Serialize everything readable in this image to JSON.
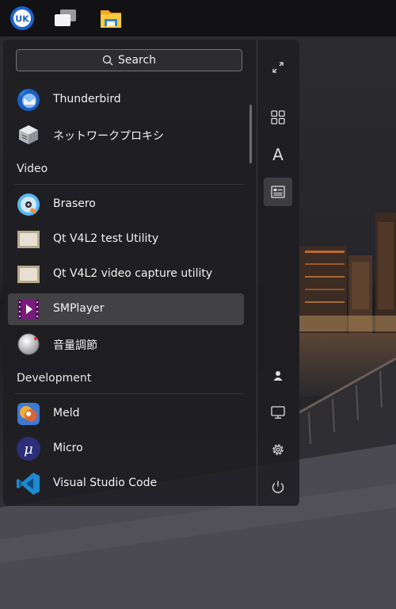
{
  "taskbar": {
    "items": [
      {
        "name": "start-menu",
        "icon": "ukui-logo-icon"
      },
      {
        "name": "multitasking",
        "icon": "windows-stack-icon"
      },
      {
        "name": "file-manager",
        "icon": "folder-icon"
      }
    ],
    "logo_text": "UK"
  },
  "menu": {
    "search_label": "Search",
    "categories": {
      "video": "Video",
      "development": "Development"
    },
    "apps": [
      {
        "label": "Thunderbird",
        "icon": "thunderbird-icon"
      },
      {
        "label": "ネットワークプロキシ",
        "icon": "network-proxy-icon"
      },
      {
        "label": "Brasero",
        "icon": "brasero-icon"
      },
      {
        "label": "Qt V4L2 test Utility",
        "icon": "qt-v4l2-icon"
      },
      {
        "label": "Qt V4L2 video capture utility",
        "icon": "qt-v4l2-icon"
      },
      {
        "label": "SMPlayer",
        "icon": "smplayer-icon",
        "highlighted": true
      },
      {
        "label": "音量調節",
        "icon": "volume-control-icon"
      },
      {
        "label": "Meld",
        "icon": "meld-icon"
      },
      {
        "label": "Micro",
        "icon": "micro-icon",
        "glyph": "μ"
      },
      {
        "label": "Visual Studio Code",
        "icon": "vscode-icon"
      }
    ],
    "sidebar": [
      {
        "name": "expand",
        "icon": "expand-icon"
      },
      {
        "name": "category-view",
        "icon": "grid-icon"
      },
      {
        "name": "alphabetical-view",
        "icon": "letter-a-icon",
        "glyph": "A"
      },
      {
        "name": "function-view",
        "icon": "function-list-icon",
        "active": true
      },
      {
        "name": "user",
        "icon": "user-icon"
      },
      {
        "name": "computer",
        "icon": "monitor-icon"
      },
      {
        "name": "settings",
        "icon": "gear-icon"
      },
      {
        "name": "power",
        "icon": "power-icon"
      }
    ]
  },
  "colors": {
    "panel": "#121215",
    "menu_bg": "#1e1e22",
    "highlight": "#ffffff29",
    "accent_blue": "#1e88e5"
  }
}
